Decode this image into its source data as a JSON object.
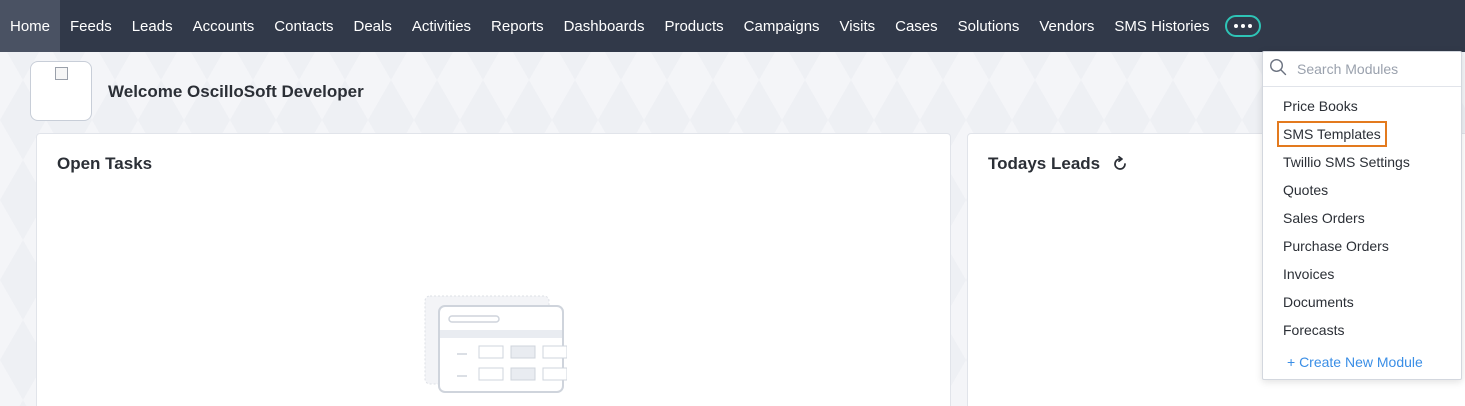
{
  "nav": {
    "items": [
      {
        "label": "Home",
        "active": true
      },
      {
        "label": "Feeds"
      },
      {
        "label": "Leads"
      },
      {
        "label": "Accounts"
      },
      {
        "label": "Contacts"
      },
      {
        "label": "Deals"
      },
      {
        "label": "Activities"
      },
      {
        "label": "Reports"
      },
      {
        "label": "Dashboards"
      },
      {
        "label": "Products"
      },
      {
        "label": "Campaigns"
      },
      {
        "label": "Visits"
      },
      {
        "label": "Cases"
      },
      {
        "label": "Solutions"
      },
      {
        "label": "Vendors"
      },
      {
        "label": "SMS Histories"
      }
    ],
    "more_icon": "more-dots-icon",
    "accent": "#2ec4b6",
    "background": "#313949"
  },
  "welcome": {
    "text": "Welcome OscilloSoft Developer"
  },
  "cards": {
    "open_tasks": {
      "title": "Open Tasks"
    },
    "todays_leads": {
      "title": "Todays Leads",
      "icon": "refresh-icon"
    }
  },
  "dropdown": {
    "search_placeholder": "Search Modules",
    "search_icon": "search-icon",
    "items": [
      {
        "label": "Price Books"
      },
      {
        "label": "SMS Templates",
        "highlighted": true
      },
      {
        "label": "Twillio SMS Settings"
      },
      {
        "label": "Quotes"
      },
      {
        "label": "Sales Orders"
      },
      {
        "label": "Purchase Orders"
      },
      {
        "label": "Invoices"
      },
      {
        "label": "Documents"
      },
      {
        "label": "Forecasts"
      }
    ],
    "create_label": "+ Create New Module",
    "highlight_color": "#e37a1e",
    "link_color": "#3a8ee6"
  }
}
